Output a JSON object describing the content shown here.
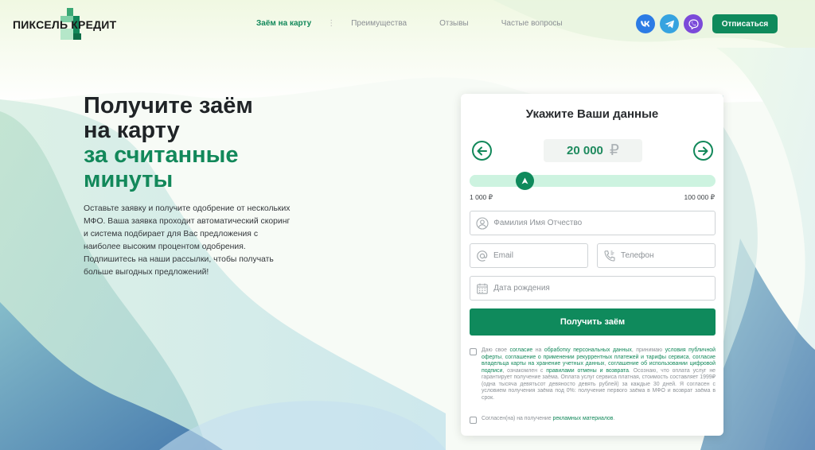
{
  "brand": {
    "name": "ПИКСЕЛЬ КРЕДИТ",
    "accent": "#0f8a5c"
  },
  "nav": {
    "items": [
      {
        "label": "Заём на карту",
        "active": true
      },
      {
        "label": "Преимущества",
        "active": false
      },
      {
        "label": "Отзывы",
        "active": false
      },
      {
        "label": "Частые вопросы",
        "active": false
      }
    ],
    "separator": "⋮"
  },
  "socials": [
    "vk-icon",
    "telegram-icon",
    "viber-icon"
  ],
  "header": {
    "unsubscribe_label": "Отписаться"
  },
  "hero": {
    "title_line1": "Получите заём",
    "title_line2": "на карту",
    "title_line3": "за считанные",
    "title_line4": "минуты",
    "description": "Оставьте заявку и получите одобрение от нескольких МФО. Ваша заявка проходит автоматический скоринг и система подбирает для Вас предложения с наиболее высоким процентом одобрения. Подпишитесь на наши рассылки, чтобы получать больше выгодных предложений!"
  },
  "form": {
    "title": "Укажите Ваши данные",
    "amount": "20 000",
    "currency": "₽",
    "range_min_label": "1 000 ₽",
    "range_max_label": "100 000 ₽",
    "slider": {
      "min": 1000,
      "max": 100000,
      "value": 20000
    },
    "fields": {
      "name_placeholder": "Фамилия Имя Отчество",
      "email_placeholder": "Email",
      "phone_placeholder": "Телефон",
      "date_placeholder": "Дата рождения"
    },
    "submit_label": "Получить заём",
    "consent1": {
      "t1": "Даю свое ",
      "l1": "согласие",
      "t2": " на ",
      "l2": "обработку персональных данных",
      "t3": ", принимаю ",
      "l3": "условия публичной оферты",
      "t4": ", ",
      "l4": "соглашение о применении рекуррентных платежей и тарифы сервиса",
      "t5": ", ",
      "l5": "согласие владельца карты на хранение учетных данных",
      "t6": ", ",
      "l6": "соглашение об использовании цифровой подписи",
      "t7": ", ознакомлен с ",
      "l7": "правилами отмены и возврата",
      "t8": ". Осознаю, что оплата услуг не гарантирует получение заёма. Оплата услуг сервиса платная, стоимость составляет 1999₽ (одна тысяча девятьсот девяносто девять рублей) за каждые 30 дней. Я согласен с условием получения заёма под 0%: получение первого заёма в МФО и возврат заёма в срок."
    },
    "consent2": {
      "t1": "Согласен(на) на получение ",
      "l1": "рекламных материалов",
      "t2": "."
    }
  }
}
